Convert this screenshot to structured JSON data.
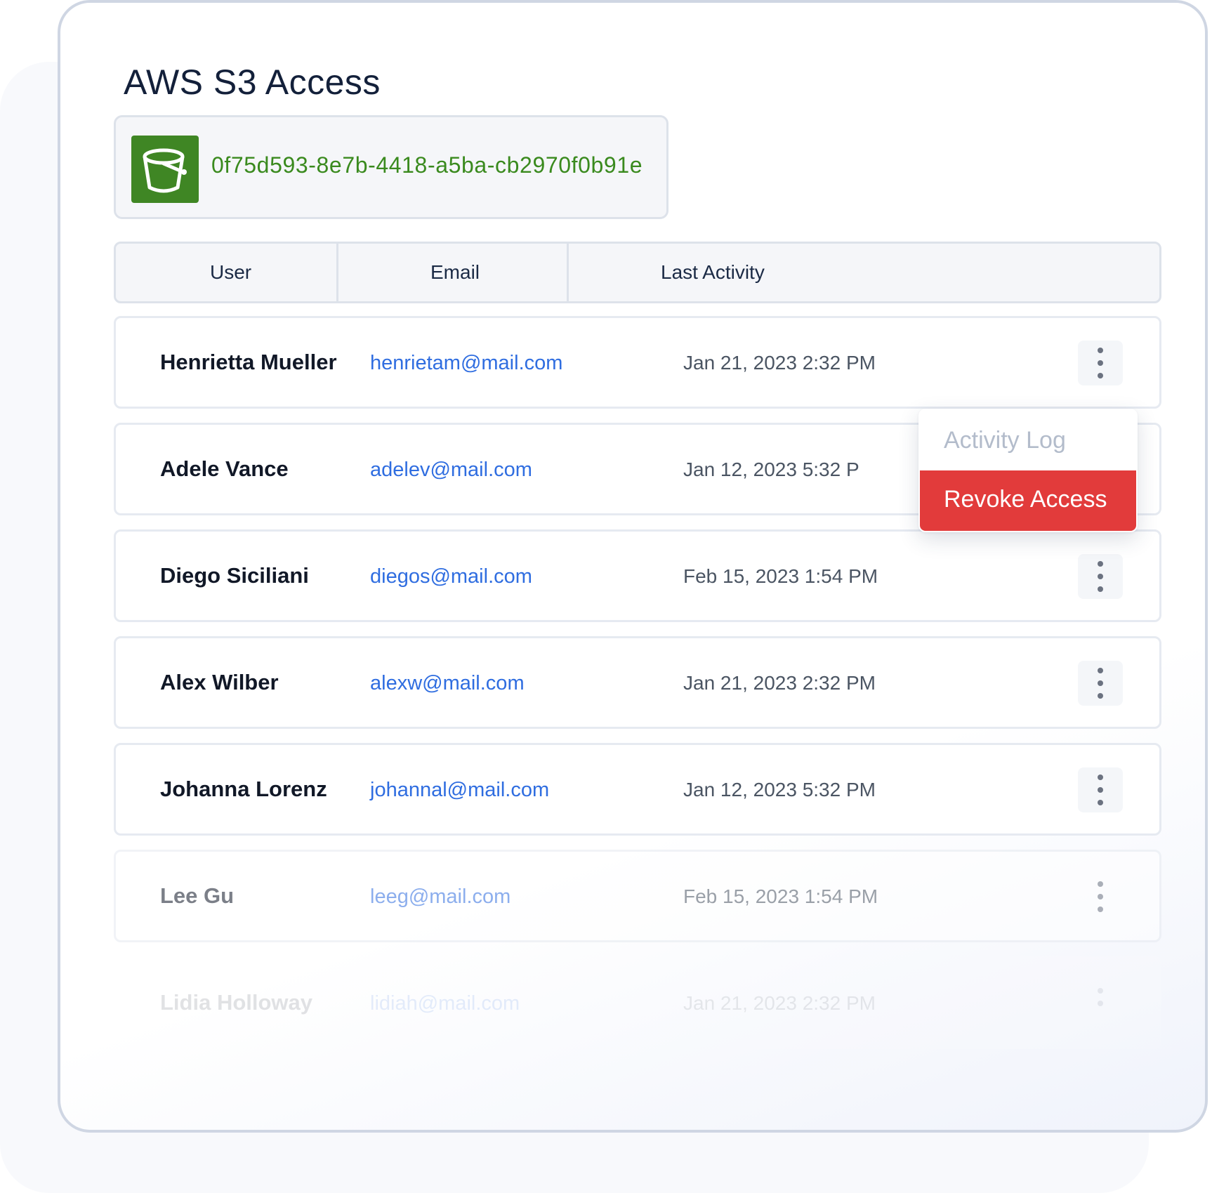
{
  "page": {
    "title": "AWS S3 Access"
  },
  "bucket": {
    "icon": "s3-bucket-icon",
    "id": "0f75d593-8e7b-4418-a5ba-cb2970f0b91e",
    "color": "#3f8624"
  },
  "table": {
    "columns": [
      "User",
      "Email",
      "Last Activity"
    ],
    "rows": [
      {
        "name": "Henrietta Mueller",
        "email": "henrietam@mail.com",
        "last_activity": "Jan 21, 2023 2:32 PM"
      },
      {
        "name": "Adele Vance",
        "email": "adelev@mail.com",
        "last_activity": "Jan 12, 2023 5:32 P"
      },
      {
        "name": "Diego Siciliani",
        "email": "diegos@mail.com",
        "last_activity": "Feb 15, 2023 1:54 PM"
      },
      {
        "name": "Alex Wilber",
        "email": "alexw@mail.com",
        "last_activity": "Jan 21, 2023 2:32 PM"
      },
      {
        "name": "Johanna Lorenz",
        "email": "johannal@mail.com",
        "last_activity": "Jan 12, 2023 5:32 PM"
      },
      {
        "name": "Lee Gu",
        "email": "leeg@mail.com",
        "last_activity": "Feb 15, 2023 1:54 PM"
      },
      {
        "name": "Lidia Holloway",
        "email": "lidiah@mail.com",
        "last_activity": "Jan 21, 2023 2:32 PM"
      }
    ]
  },
  "context_menu": {
    "items": [
      "Activity Log",
      "Revoke Access"
    ],
    "danger_color": "#e23b3b"
  },
  "colors": {
    "email_link": "#2f6de0",
    "bucket_id": "#3a8a1e"
  }
}
